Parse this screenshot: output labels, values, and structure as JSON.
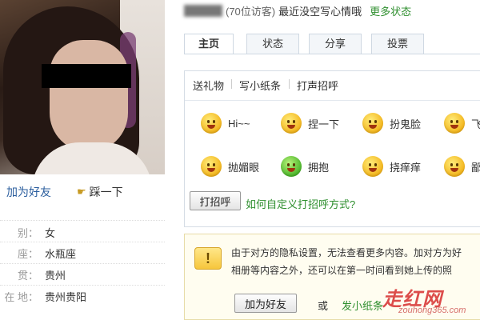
{
  "profile": {
    "stomp_label": "踩一下",
    "add_friend_label": "加为好友",
    "info": [
      {
        "key": "别：",
        "value": "女"
      },
      {
        "key": "座：",
        "value": "水瓶座"
      },
      {
        "key": "贯：",
        "value": "贵州"
      },
      {
        "key": "在 地：",
        "value": "贵州贵阳"
      }
    ]
  },
  "header": {
    "visitors": "(70位访客)",
    "mood": "最近没空写心情哦",
    "more_status": "更多状态"
  },
  "tabs": [
    {
      "label": "主页",
      "active": true
    },
    {
      "label": "状态",
      "active": false
    },
    {
      "label": "分享",
      "active": false
    },
    {
      "label": "投票",
      "active": false
    }
  ],
  "subnav": [
    "送礼物",
    "写小纸条",
    "打声招呼"
  ],
  "greetings": [
    {
      "label": "Hi~~",
      "icon": "hi-smiley-icon"
    },
    {
      "label": "捏一下",
      "icon": "laughing-face-icon"
    },
    {
      "label": "扮鬼脸",
      "icon": "silly-face-icon"
    },
    {
      "label": "飞",
      "icon": "kiss-face-icon"
    },
    {
      "label": "抛媚眼",
      "icon": "wink-face-icon"
    },
    {
      "label": "拥抱",
      "icon": "hug-face-icon"
    },
    {
      "label": "挠痒痒",
      "icon": "tickle-face-icon"
    },
    {
      "label": "鄙",
      "icon": "scorn-face-icon"
    }
  ],
  "greet_button": "打招呼",
  "custom_greet_link": "如何自定义打招呼方式?",
  "notice": {
    "line1": "由于对方的隐私设置，无法查看更多内容。加对方为好",
    "line2": "相册等内容之外，还可以在第一时间看到她上传的照",
    "add_button": "加为好友",
    "or": "或",
    "note_link": "发小纸条"
  },
  "watermark": {
    "main": "走红网",
    "url": "zouhong365.com"
  },
  "colors": {
    "link_blue": "#2b5e9e",
    "link_green": "#2f8f2f",
    "notice_bg": "#fffdf0"
  }
}
